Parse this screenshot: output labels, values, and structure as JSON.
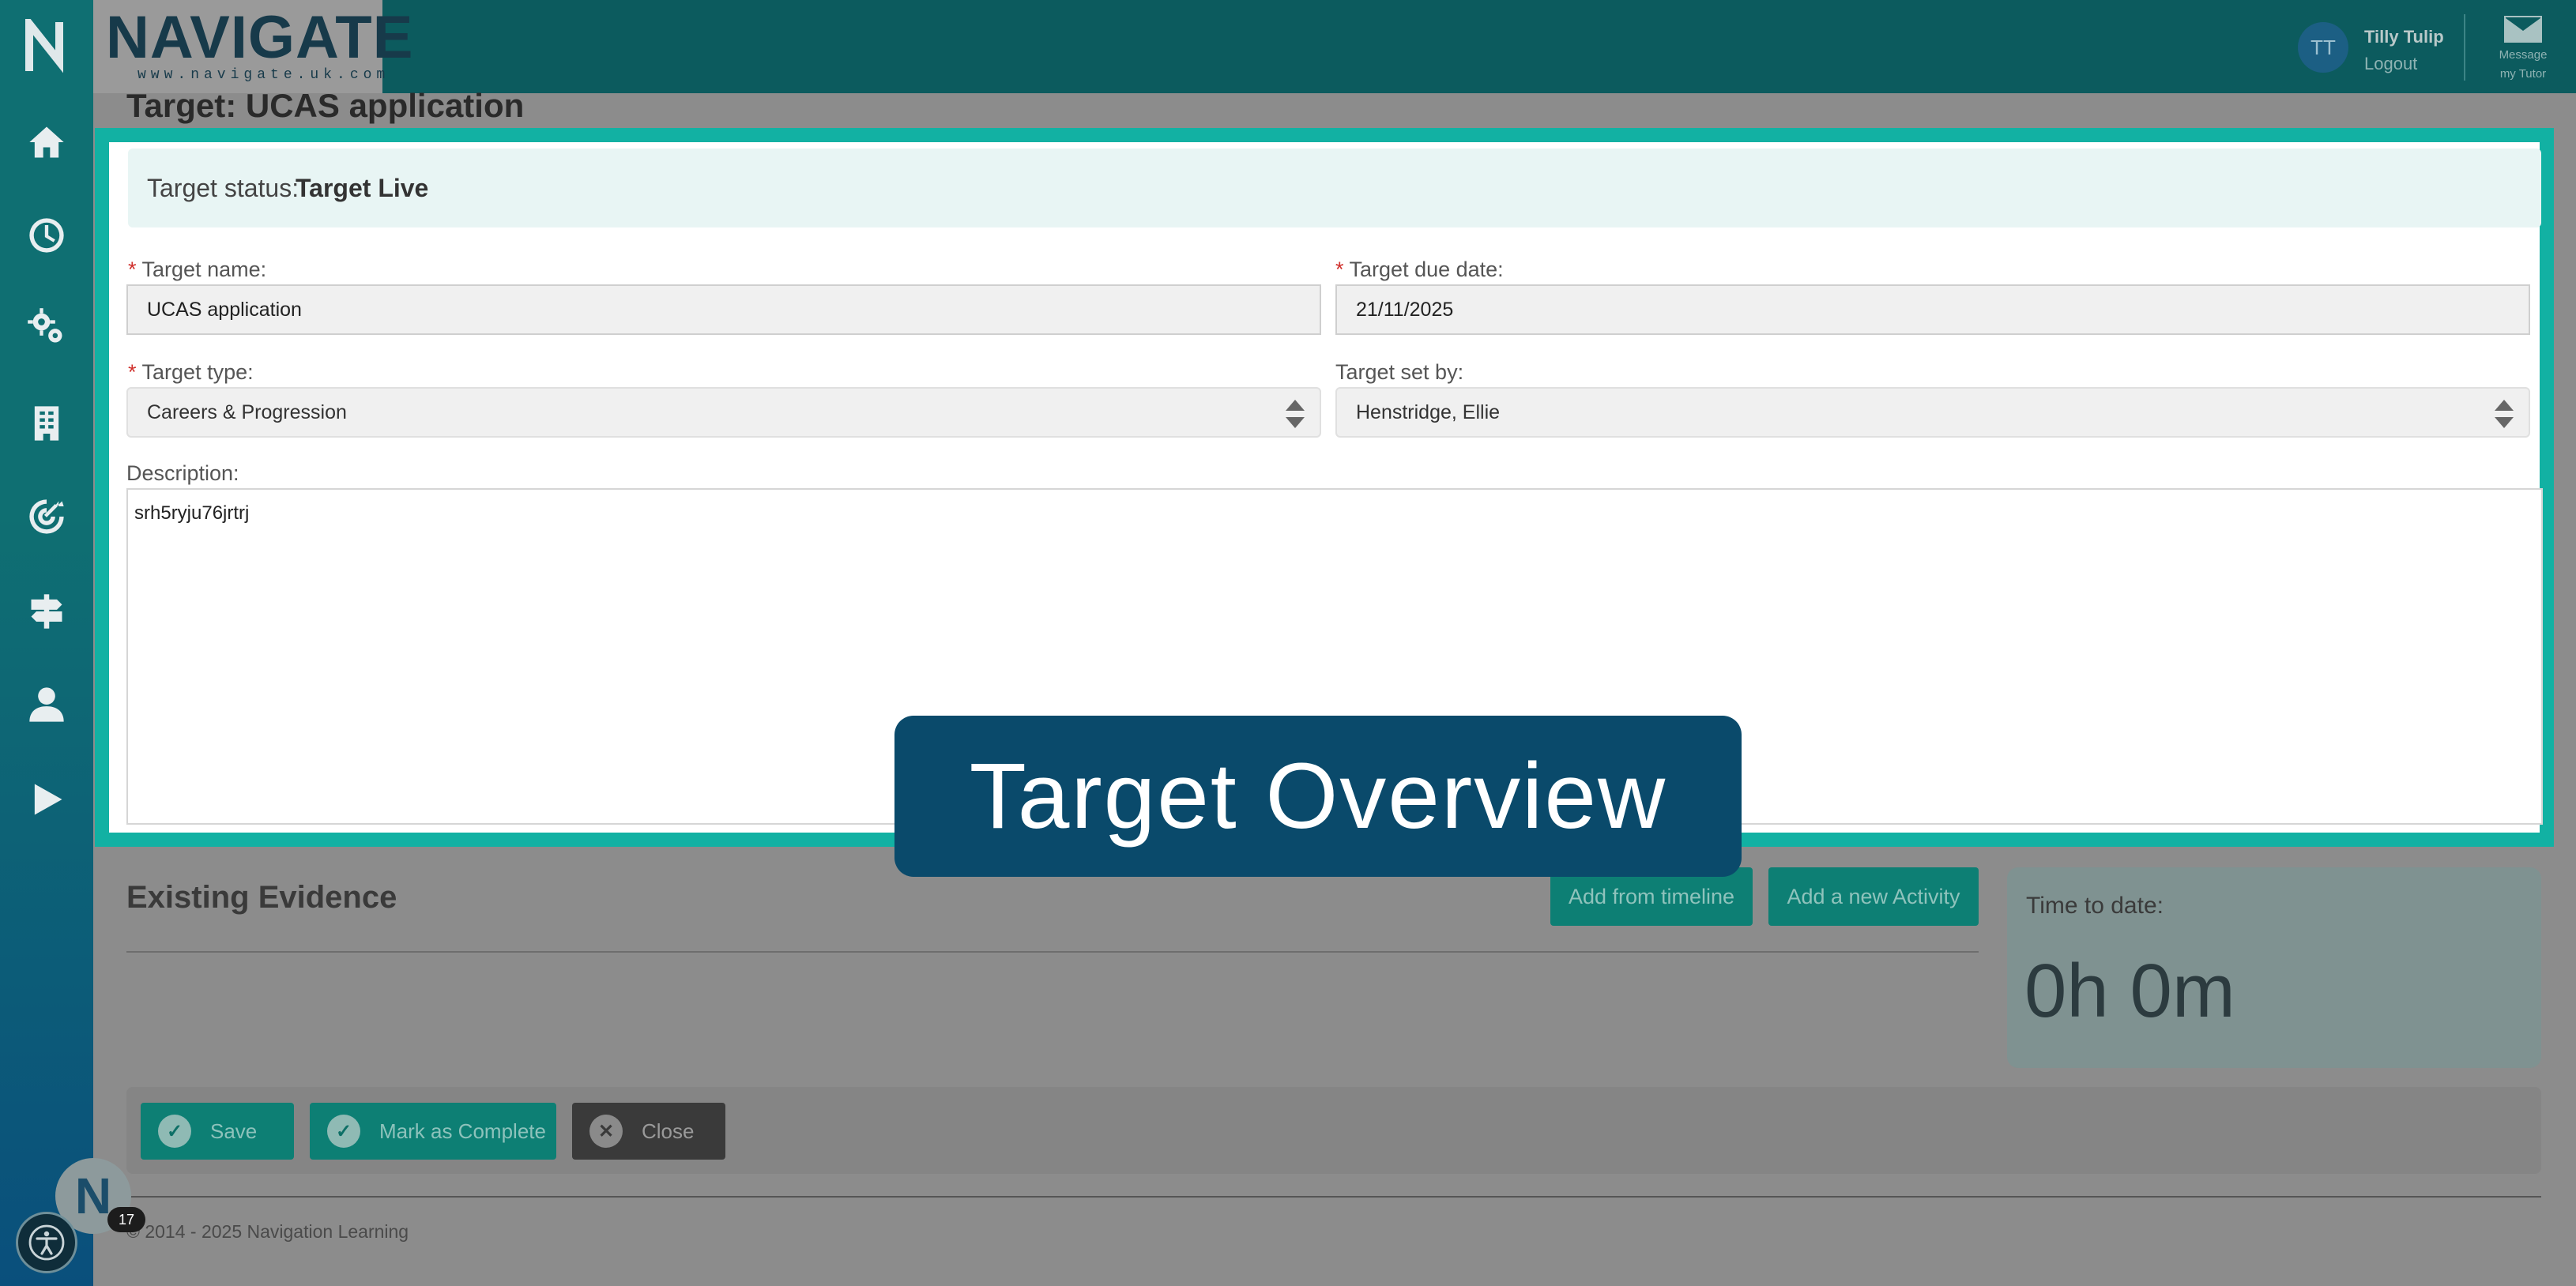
{
  "app": {
    "brand_name": "NAVIGATE",
    "brand_url": "www.navigate.uk.com",
    "sidebar_logo": "N",
    "sidebar_icons": [
      "home-icon",
      "clock-icon",
      "gears-icon",
      "building-icon",
      "target-icon",
      "signpost-icon",
      "person-icon",
      "play-icon"
    ]
  },
  "user": {
    "initials": "TT",
    "name": "Tilly Tulip",
    "logout_label": "Logout"
  },
  "message_tutor": {
    "line1": "Message",
    "line2": "my Tutor"
  },
  "page": {
    "title": "Target: UCAS application"
  },
  "target": {
    "status_label": "Target status:",
    "status_value": "Target Live",
    "required_marker": "*",
    "name_label": "Target name:",
    "name_value": "UCAS application",
    "due_label": "Target due date:",
    "due_value": "21/11/2025",
    "type_label": "Target type:",
    "type_value": "Careers & Progression",
    "set_by_label": "Target set by:",
    "set_by_value": "Henstridge, Ellie",
    "description_label": "Description:",
    "description_value": "srh5ryju76jrtrj"
  },
  "evidence": {
    "title": "Existing Evidence",
    "add_timeline_label": "Add from timeline",
    "add_activity_label": "Add a new Activity"
  },
  "time": {
    "label": "Time to date:",
    "value": "0h 0m"
  },
  "actions": {
    "save_label": "Save",
    "complete_label": "Mark as Complete",
    "close_label": "Close"
  },
  "footer": {
    "copyright": "© 2014 - 2025 Navigation Learning"
  },
  "chat_bubble": {
    "letter": "N",
    "badge_count": "17"
  },
  "overlay": {
    "text": "Target Overview"
  },
  "colors": {
    "highlight": "#12b1a3",
    "header": "#0c5b5e",
    "overlay": "#0a4a6b"
  }
}
